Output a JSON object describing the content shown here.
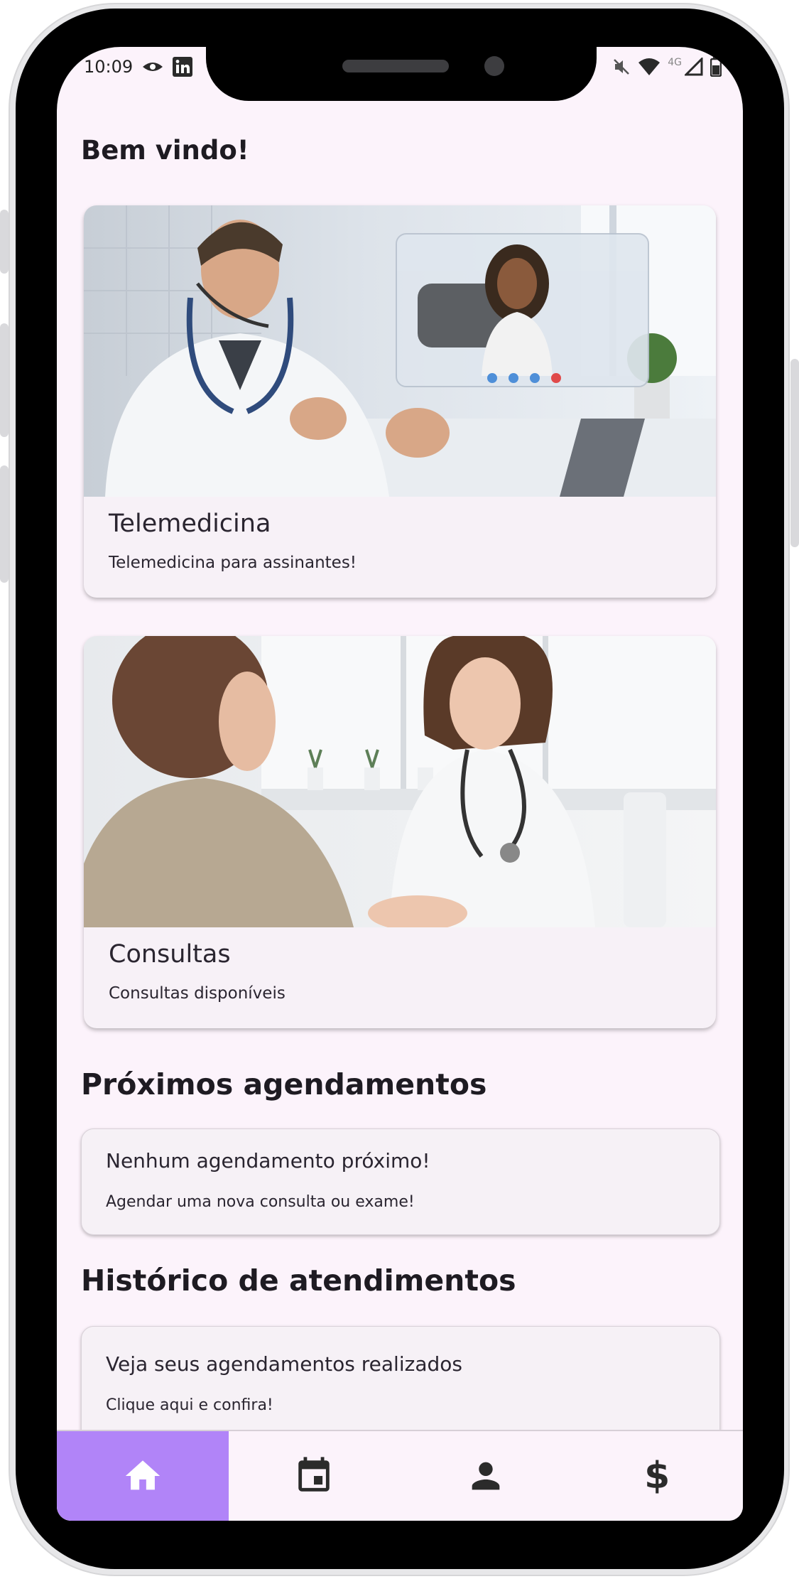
{
  "status_bar": {
    "time": "10:09",
    "network": "4G"
  },
  "home": {
    "welcome": "Bem vindo!",
    "cards": [
      {
        "title": "Telemedicina",
        "subtitle": "Telemedicina para assinantes!"
      },
      {
        "title": "Consultas",
        "subtitle": "Consultas disponíveis"
      }
    ],
    "next_section": {
      "title": "Próximos agendamentos",
      "card_title": "Nenhum agendamento próximo!",
      "card_sub": "Agendar uma nova consulta ou exame!"
    },
    "history_section": {
      "title": "Histórico de atendimentos",
      "card_title": "Veja seus agendamentos realizados",
      "card_sub": "Clique aqui e confira!"
    }
  },
  "nav": {
    "dollar_glyph": "$",
    "active_color": "#b184f8"
  },
  "icons": [
    "home-icon",
    "calendar-icon",
    "person-icon",
    "dollar-icon"
  ]
}
